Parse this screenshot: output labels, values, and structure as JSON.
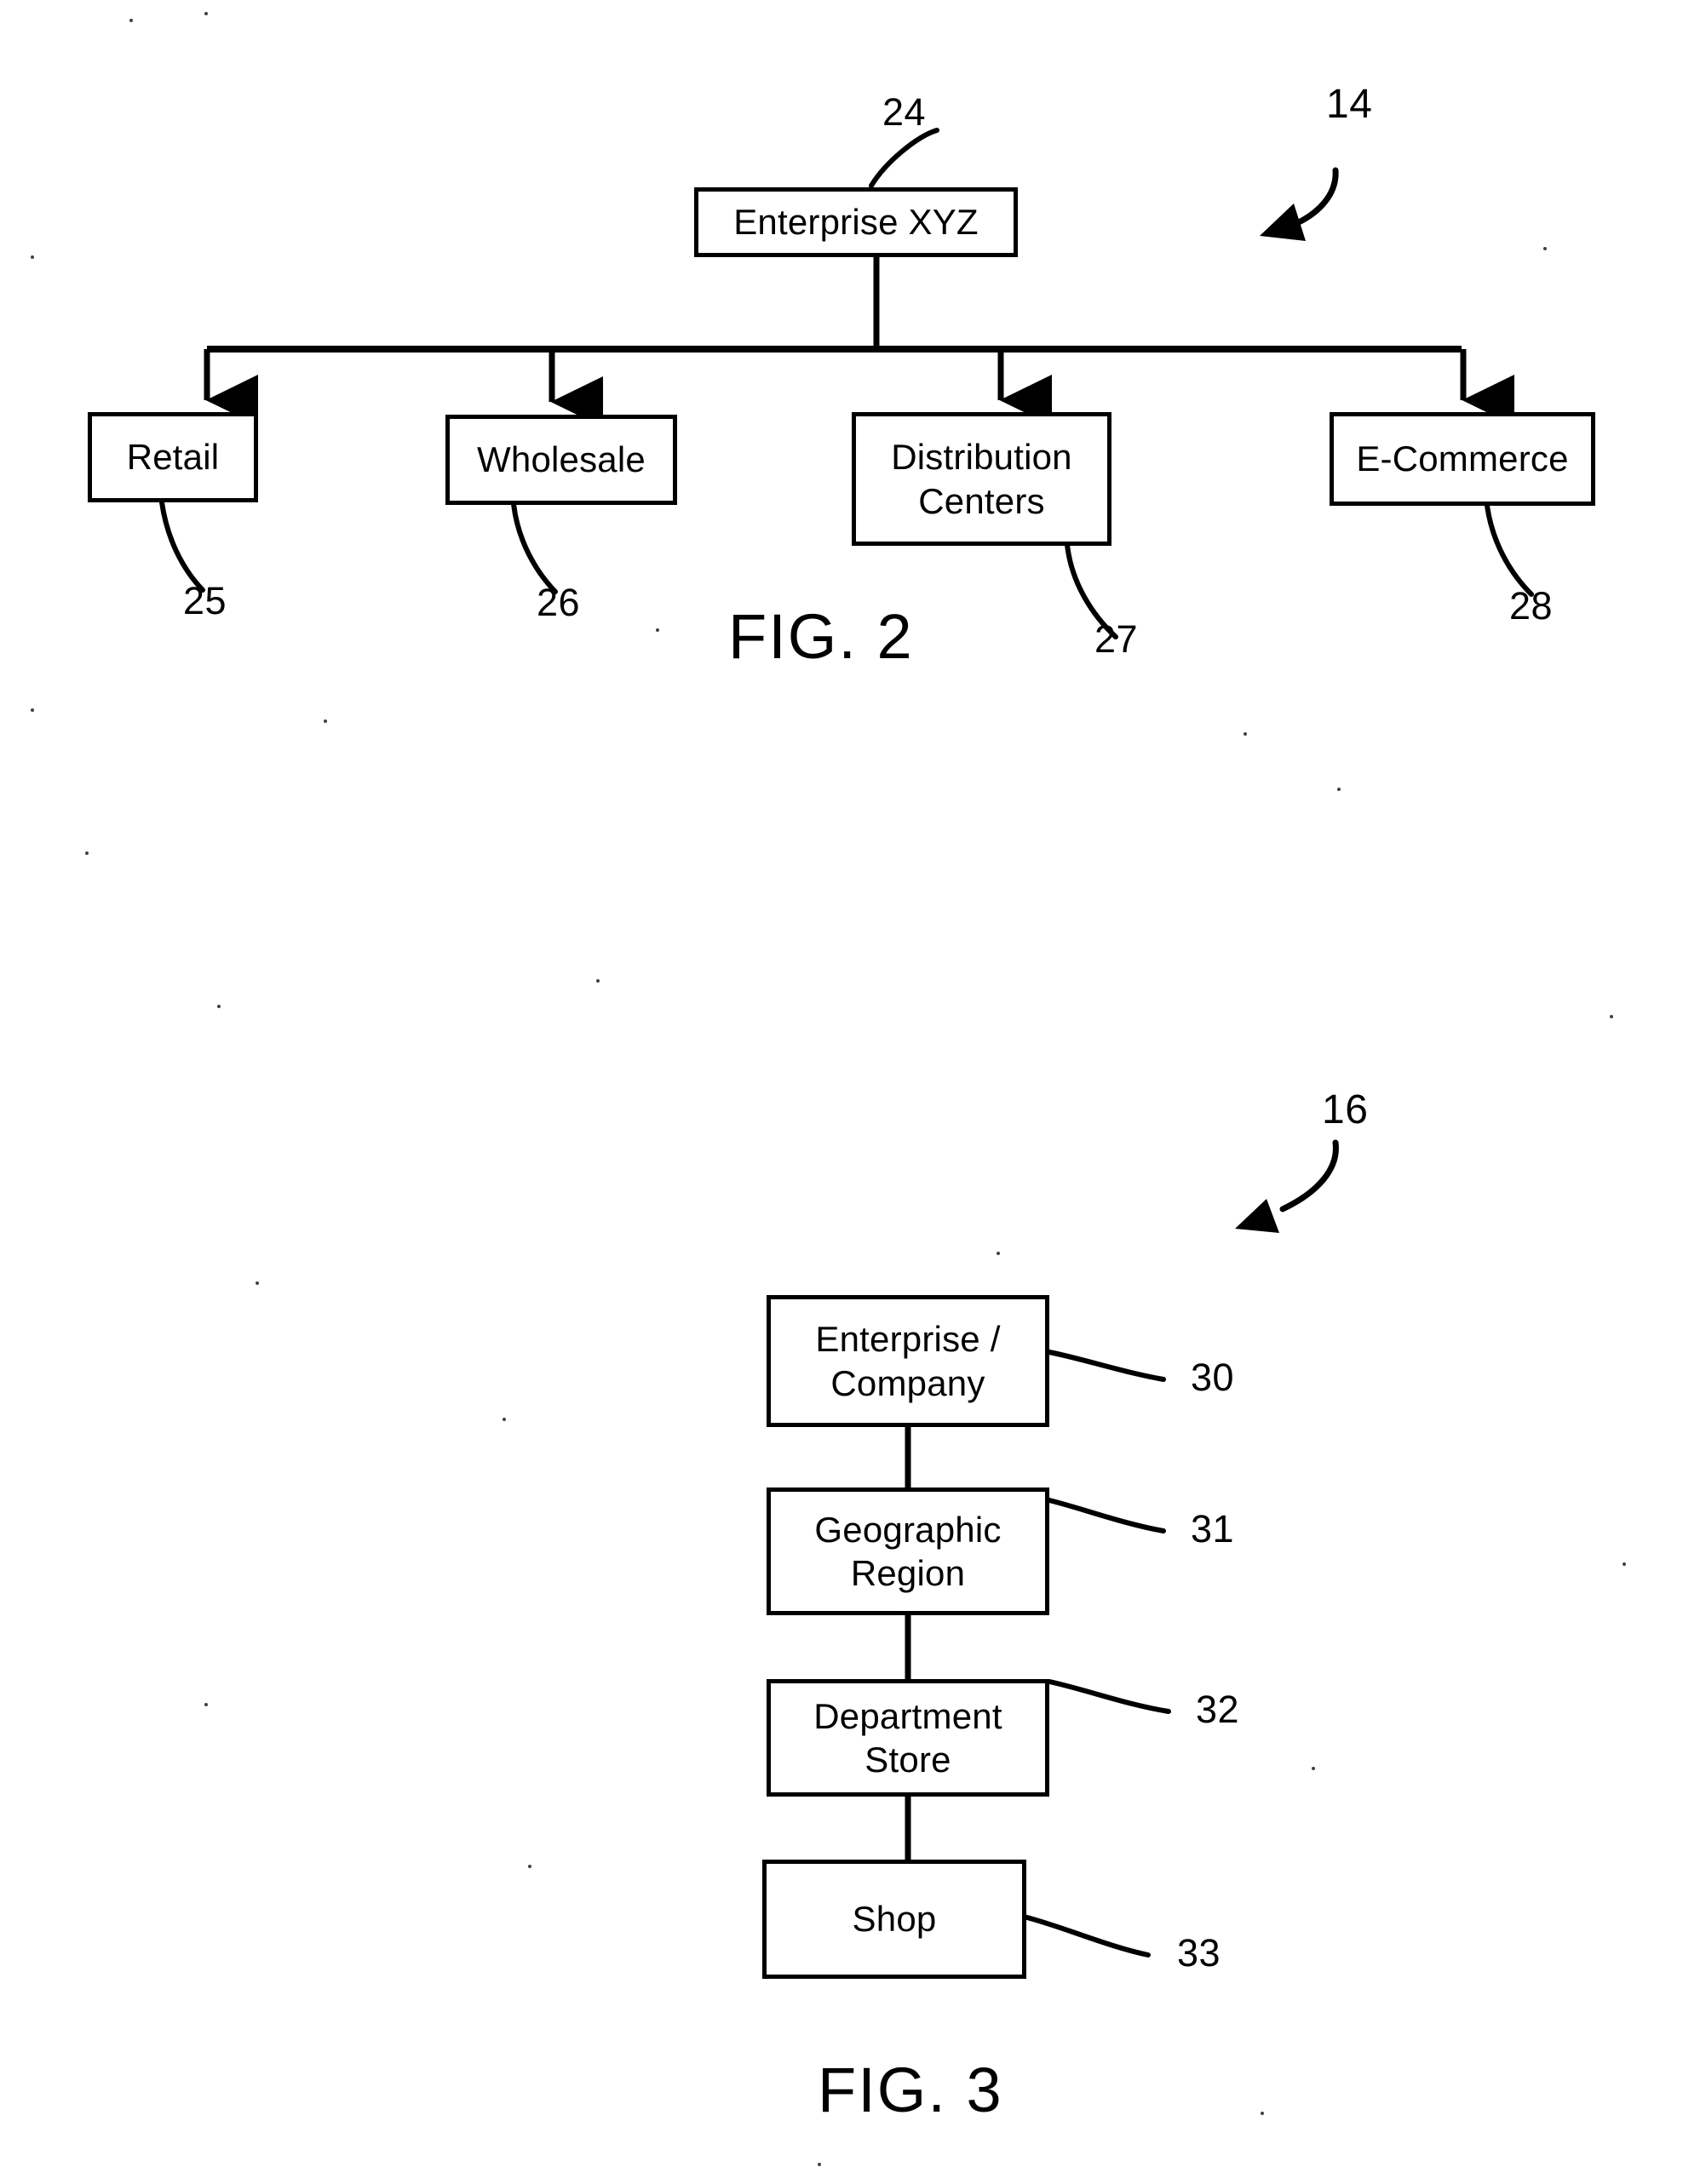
{
  "document": {
    "type": "patent-drawing-sheet",
    "background_color": "#ffffff",
    "ink_color": "#000000"
  },
  "figures": [
    {
      "id": "fig2",
      "caption": "FIG. 2",
      "figure_ref": "14",
      "root": {
        "label": "Enterprise XYZ",
        "ref": "24"
      },
      "children": [
        {
          "label": "Retail",
          "ref": "25"
        },
        {
          "label": "Wholesale",
          "ref": "26"
        },
        {
          "label": "Distribution\nCenters",
          "ref": "27"
        },
        {
          "label": "E-Commerce",
          "ref": "28"
        }
      ]
    },
    {
      "id": "fig3",
      "caption": "FIG. 3",
      "figure_ref": "16",
      "levels": [
        {
          "label": "Enterprise /\nCompany",
          "ref": "30"
        },
        {
          "label": "Geographic\nRegion",
          "ref": "31"
        },
        {
          "label": "Department\nStore",
          "ref": "32"
        },
        {
          "label": "Shop",
          "ref": "33"
        }
      ]
    }
  ]
}
